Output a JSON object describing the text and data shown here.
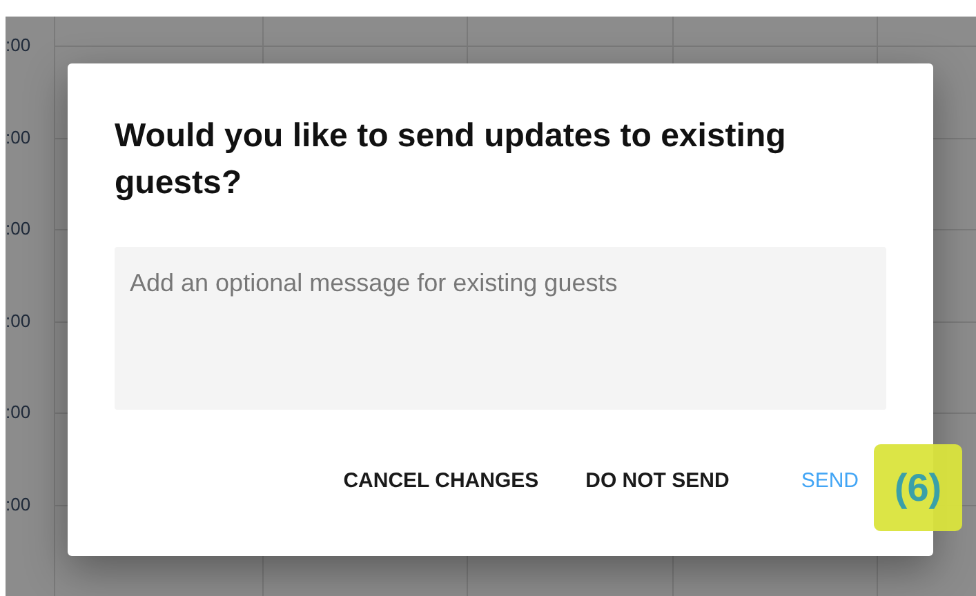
{
  "background": {
    "time_labels": [
      ":00",
      ":00",
      ":00",
      ":00",
      ":00",
      ":00"
    ]
  },
  "dialog": {
    "title": "Would you like to send updates to existing guests?",
    "message_field": {
      "placeholder": "Add an optional message for existing guests"
    },
    "buttons": [
      {
        "label": "CANCEL CHANGES",
        "kind": "plain"
      },
      {
        "label": "DO NOT SEND",
        "kind": "plain"
      },
      {
        "label": "SEND",
        "kind": "primary"
      }
    ]
  },
  "callout": {
    "label": "(6)"
  }
}
